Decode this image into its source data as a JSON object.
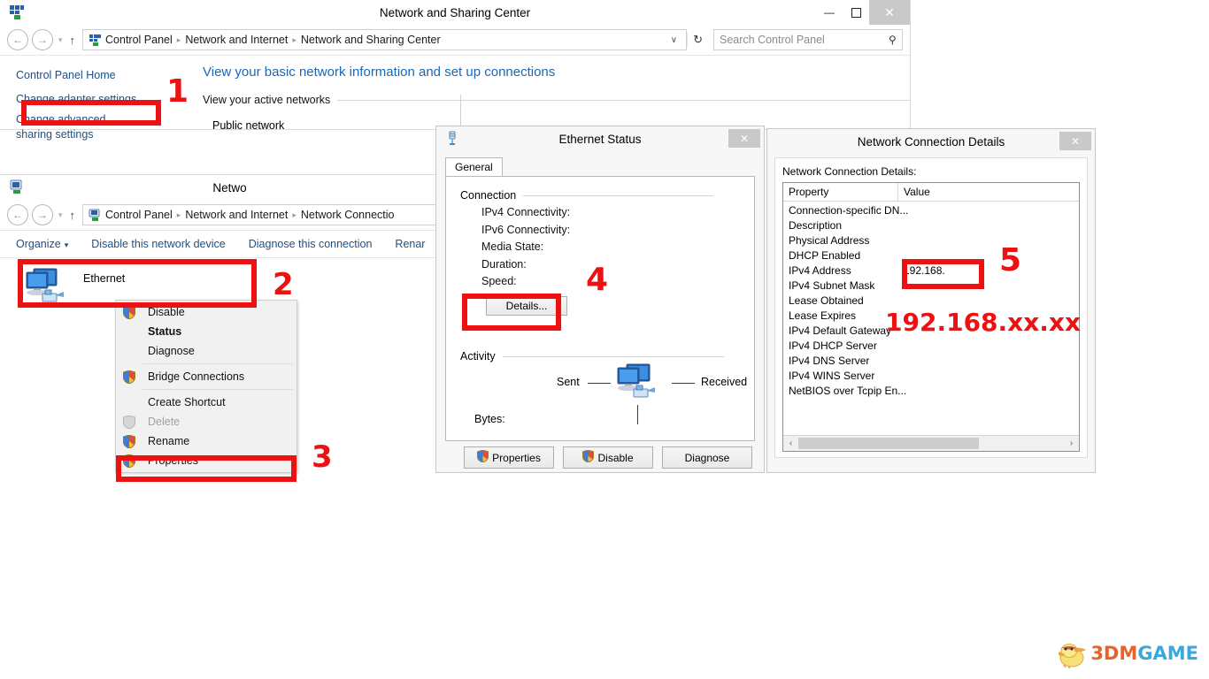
{
  "nsc_window": {
    "title": "Network and Sharing Center",
    "icon": "network-sharing-icon",
    "window_buttons": {
      "minimize": "—",
      "maximize": "❐",
      "close": "✕"
    },
    "address": {
      "back": "←",
      "forward": "→",
      "recent_chevron": "▾",
      "up": "↑",
      "crumbs": [
        "Control Panel",
        "Network and Internet",
        "Network and Sharing Center"
      ],
      "dropdown": "∨",
      "refresh": "↻"
    },
    "search": {
      "placeholder": "Search Control Panel",
      "icon": "search-icon"
    },
    "sidebar": {
      "items": [
        "Control Panel Home",
        "Change adapter settings",
        "Change advanced sharing settings"
      ]
    },
    "content": {
      "heading": "View your basic network information and set up connections",
      "subheading": "View your active networks",
      "network_label": "Public network"
    }
  },
  "nc_window": {
    "title": "Netwo",
    "icon": "network-connections-icon",
    "address": {
      "back": "←",
      "forward": "→",
      "recent_chevron": "▾",
      "up": "↑",
      "crumbs": [
        "Control Panel",
        "Network and Internet",
        "Network Connectio"
      ]
    },
    "toolbar": {
      "organize": "Organize",
      "organize_caret": "▾",
      "disable": "Disable this network device",
      "diagnose": "Diagnose this connection",
      "rename": "Renar"
    },
    "connection": {
      "name": "Ethernet",
      "icon": "ethernet-adapter-icon"
    }
  },
  "context_menu": {
    "items": [
      {
        "label": "Disable",
        "shield": true,
        "bold": false,
        "disabled": false
      },
      {
        "label": "Status",
        "shield": false,
        "bold": true,
        "disabled": false
      },
      {
        "label": "Diagnose",
        "shield": false,
        "bold": false,
        "disabled": false
      },
      {
        "label": "Bridge Connections",
        "shield": true,
        "bold": false,
        "disabled": false
      },
      {
        "label": "Create Shortcut",
        "shield": false,
        "bold": false,
        "disabled": false
      },
      {
        "label": "Delete",
        "shield": true,
        "bold": false,
        "disabled": true
      },
      {
        "label": "Rename",
        "shield": true,
        "bold": false,
        "disabled": false
      },
      {
        "label": "Properties",
        "shield": true,
        "bold": false,
        "disabled": false
      }
    ]
  },
  "ethernet_status": {
    "title": "Ethernet Status",
    "icon": "network-status-icon",
    "close": "✕",
    "tab": "General",
    "connection_group": "Connection",
    "fields": [
      "IPv4 Connectivity:",
      "IPv6 Connectivity:",
      "Media State:",
      "Duration:",
      "Speed:"
    ],
    "details_button": "Details...",
    "activity_group": "Activity",
    "sent_label": "Sent",
    "received_label": "Received",
    "bytes_label": "Bytes:",
    "activity_icon": "ethernet-adapter-icon",
    "buttons": [
      {
        "label": "Properties",
        "shield": true
      },
      {
        "label": "Disable",
        "shield": true
      },
      {
        "label": "Diagnose",
        "shield": false
      }
    ]
  },
  "network_connection_details": {
    "title": "Network Connection Details",
    "close": "✕",
    "caption": "Network Connection Details:",
    "columns": [
      "Property",
      "Value"
    ],
    "rows": [
      {
        "property": "Connection-specific DN...",
        "value": ""
      },
      {
        "property": "Description",
        "value": ""
      },
      {
        "property": "Physical Address",
        "value": ""
      },
      {
        "property": "DHCP Enabled",
        "value": ""
      },
      {
        "property": "IPv4 Address",
        "value": "192.168."
      },
      {
        "property": "IPv4 Subnet Mask",
        "value": ""
      },
      {
        "property": "Lease Obtained",
        "value": ""
      },
      {
        "property": "Lease Expires",
        "value": ""
      },
      {
        "property": "IPv4 Default Gateway",
        "value": ""
      },
      {
        "property": "IPv4 DHCP Server",
        "value": ""
      },
      {
        "property": "IPv4 DNS Server",
        "value": ""
      },
      {
        "property": "IPv4 WINS Server",
        "value": ""
      },
      {
        "property": "NetBIOS over Tcpip En...",
        "value": ""
      }
    ],
    "scroll_left": "‹",
    "scroll_right": "›"
  },
  "annotations": {
    "color": "#ee1111",
    "steps": [
      "1",
      "2",
      "3",
      "4",
      "5"
    ],
    "ip_note": "192.168.xx.xx"
  },
  "watermark": {
    "part1": "3DM",
    "part2": "GAME",
    "icon": "3dmgame-bird-logo"
  }
}
